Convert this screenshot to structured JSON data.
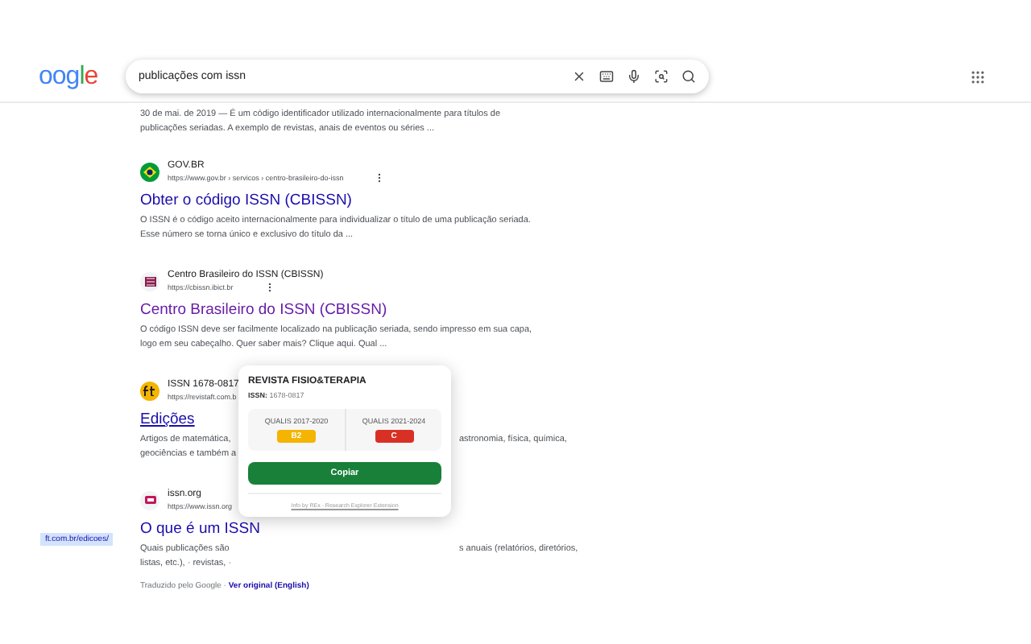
{
  "header": {
    "logo": "oogle",
    "query": "publicações com issn"
  },
  "top_snippet": [
    "30 de mai. de 2019 — É um código identificador utilizado internacionalmente para títulos de",
    "publicações seriadas. A exemplo de revistas, anais de eventos ou séries ..."
  ],
  "results": [
    {
      "kind": "flag",
      "site": "GOV.BR",
      "url": "https://www.gov.br › servicos › centro-brasileiro-do-issn",
      "title": "Obter o código ISSN (CBISSN)",
      "visited": false,
      "hovered": false,
      "menu": true,
      "lines": [
        [
          "O ISSN é o código aceito internacionalmente para individualizar o título de uma publicação seriada."
        ],
        [
          "Esse número se torna único e exclusivo do título da ..."
        ]
      ]
    },
    {
      "kind": "cbissn",
      "site": "Centro Brasileiro do ISSN (CBISSN)",
      "url": "https://cbissn.ibict.br",
      "title": "Centro Brasileiro do ISSN (CBISSN)",
      "visited": true,
      "hovered": false,
      "menu": true,
      "lines": [
        [
          "O código ISSN deve ser facilmente localizado na publicação seriada, sendo impresso em sua capa,"
        ],
        [
          "logo em seu cabeçalho. Quer saber mais? Clique aqui. Qual ..."
        ]
      ]
    },
    {
      "kind": "ft",
      "site": "ISSN 1678-0817",
      "url": "https://revistaft.com.b",
      "title": "Edições",
      "visited": false,
      "hovered": true,
      "lines": [
        [
          "Artigos de matemática,",
          "astronomia, física, química,"
        ],
        [
          "geociências e também a"
        ]
      ]
    },
    {
      "kind": "issn",
      "site": "issn.org",
      "url": "https://www.issn.org",
      "title": "O que é um ISSN",
      "visited": false,
      "hovered": false,
      "lines": [
        [
          "Quais publicações são",
          "s anuais (relatórios, diretórios,"
        ],
        [
          "listas, etc.), · revistas, ·"
        ]
      ]
    }
  ],
  "status_link": "ft.com.br/edicoes/",
  "translation": {
    "note": "Traduzido pelo Google · ",
    "link": "Ver original (English)"
  },
  "popup": {
    "title": "REVISTA FISIO&TERAPIA",
    "issn_label": "ISSN:",
    "issn": "1678-0817",
    "qualis": [
      {
        "label": "QUALIS 2017-2020",
        "grade": "B2",
        "color": "#f4b400"
      },
      {
        "label": "QUALIS 2021-2024",
        "grade": "C",
        "color": "#d93025"
      }
    ],
    "button": "Copiar",
    "footer": "Info by REx - Research Explorer Extension"
  }
}
